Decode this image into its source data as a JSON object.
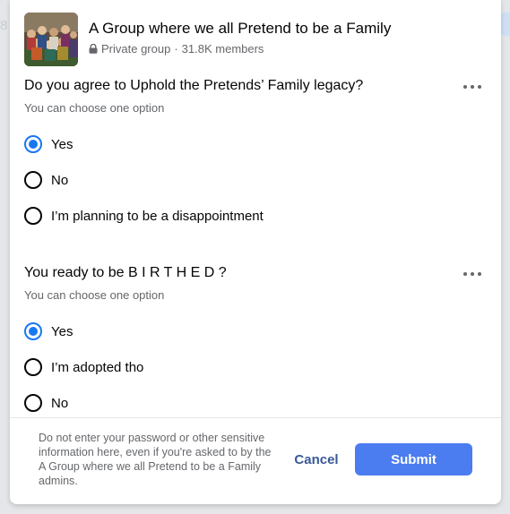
{
  "background": {
    "left_peek_text": "8"
  },
  "group": {
    "name": "A Group where we all Pretend to be a Family",
    "privacy": "Private group",
    "separator": "·",
    "members": "31.8K members"
  },
  "questions": [
    {
      "title": "Do you agree to Uphold the Pretends’ Family legacy?",
      "subtitle": "You can choose one option",
      "options": [
        {
          "label": "Yes",
          "checked": true
        },
        {
          "label": "No",
          "checked": false
        },
        {
          "label": "I’m planning to be a disappointment",
          "checked": false
        }
      ]
    },
    {
      "title": "You ready to be B I R T H E D ?",
      "subtitle": "You can choose one option",
      "options": [
        {
          "label": "Yes",
          "checked": true
        },
        {
          "label": "I’m adopted tho",
          "checked": false
        },
        {
          "label": "No",
          "checked": false
        }
      ]
    }
  ],
  "footer": {
    "disclaimer": "Do not enter your password or other sensitive information here, even if you're asked to by the A Group where we all Pretend to be a Family admins.",
    "cancel_label": "Cancel",
    "submit_label": "Submit"
  },
  "colors": {
    "accent": "#1877f2",
    "submit_bg": "#4b7df0",
    "cancel_text": "#385898"
  }
}
